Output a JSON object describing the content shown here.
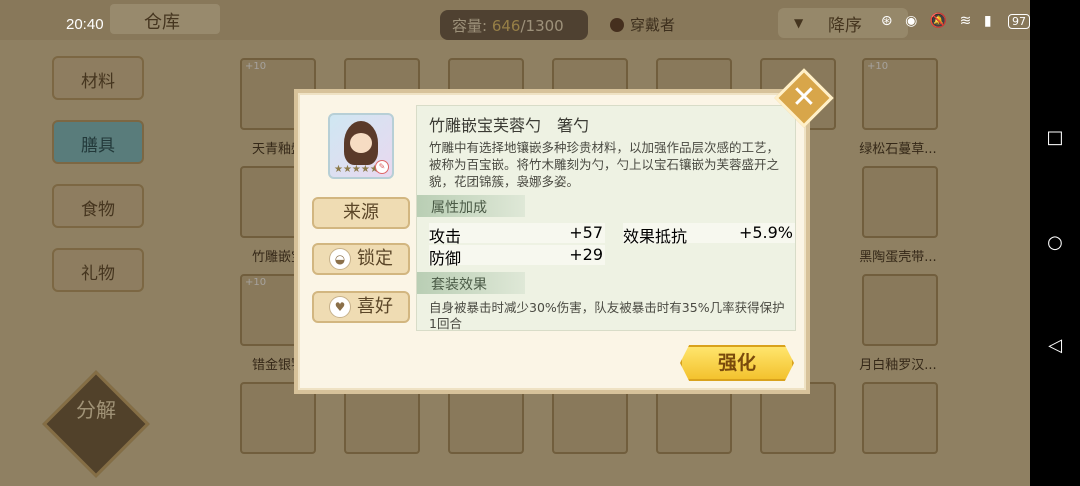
{
  "status_bar": {
    "time": "20:40",
    "icons": [
      "signal-icon",
      "eye-icon",
      "mute-icon",
      "wifi-icon",
      "4g-icon"
    ],
    "battery": "97"
  },
  "header": {
    "warehouse_label": "仓库",
    "capacity_label": "容量:",
    "capacity_used": "646",
    "capacity_total": "/1300",
    "wearer_label": "穿戴者",
    "sort_label": "降序"
  },
  "sidebar": {
    "items": [
      {
        "label": "材料",
        "active": false
      },
      {
        "label": "膳具",
        "active": true
      },
      {
        "label": "食物",
        "active": false
      },
      {
        "label": "礼物",
        "active": false
      }
    ],
    "split_label": "分解"
  },
  "grid": {
    "level_badge": "+10",
    "visible_names": [
      "天青釉盤",
      "绿松石蔓草...",
      "竹雕嵌宝",
      "黑陶蛋壳带...",
      "错金银饕",
      "月白釉罗汉..."
    ]
  },
  "dialog": {
    "item_name": "竹雕嵌宝芙蓉勺",
    "item_type": "箸勺",
    "item_stars": "★★★★★",
    "description": "竹雕中有选择地镶嵌多种珍贵材料，以加强作品层次感的工艺，被称为百宝嵌。将竹木雕刻为勺，勺上以宝石镶嵌为芙蓉盛开之貌，花团锦簇，袅娜多姿。",
    "buttons": {
      "source": "来源",
      "lock": "锁定",
      "favorite": "喜好",
      "enhance": "强化"
    },
    "attributes_header": "属性加成",
    "attributes": [
      {
        "label": "攻击",
        "value": "+57"
      },
      {
        "label": "效果抵抗",
        "value": "+5.9%"
      },
      {
        "label": "防御",
        "value": "+29"
      }
    ],
    "set_header": "套装效果",
    "set_description": "自身被暴击时减少30%伤害，队友被暴击时有35%几率获得保护1回合"
  },
  "nav": {
    "icons": [
      "recent-apps-icon",
      "home-icon",
      "back-icon"
    ]
  }
}
